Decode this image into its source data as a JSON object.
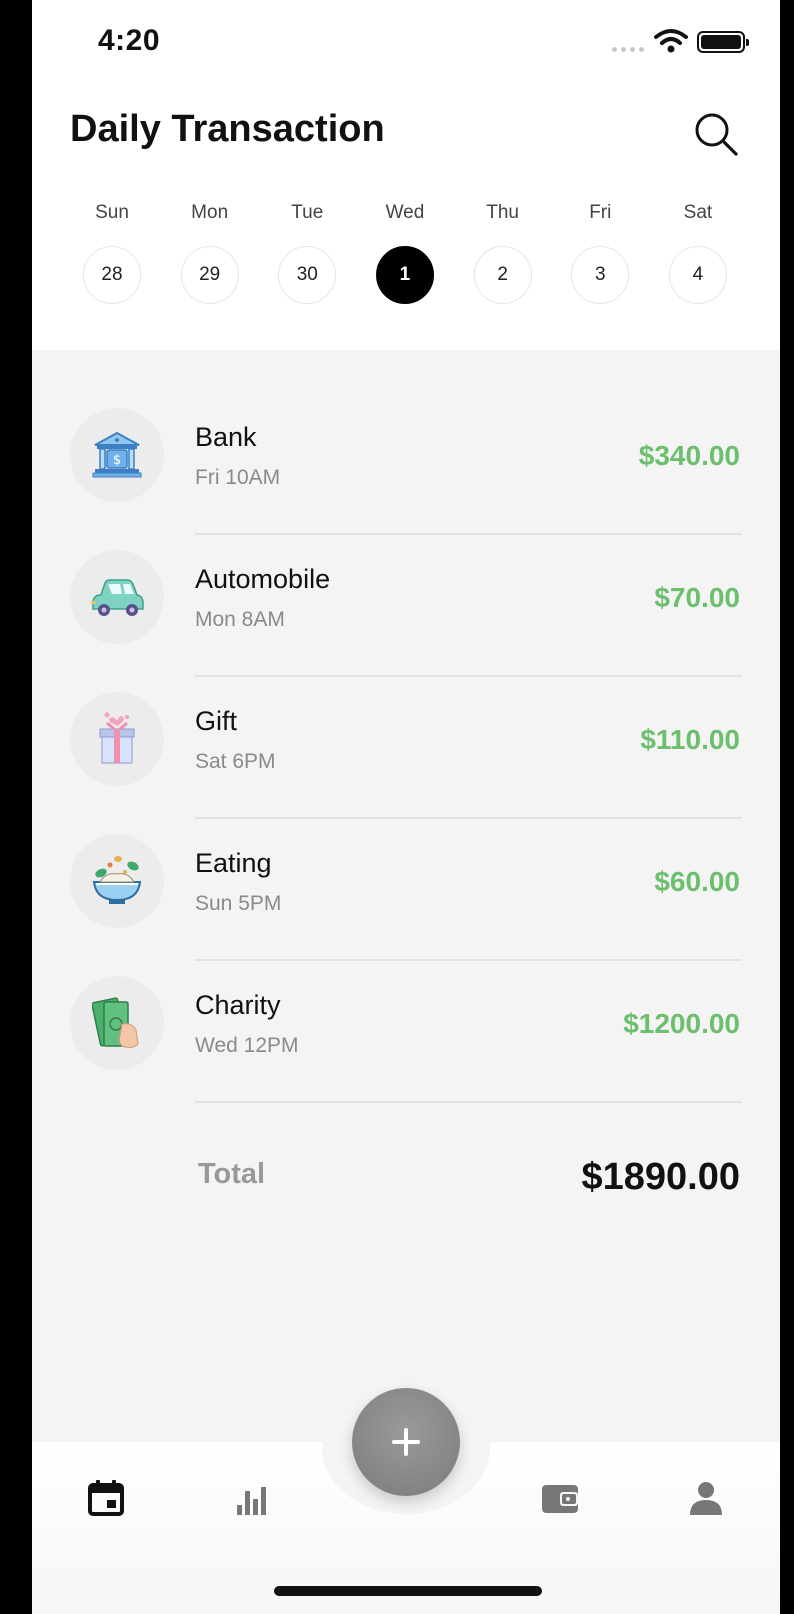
{
  "status_bar": {
    "time": "4:20"
  },
  "header": {
    "title": "Daily Transaction"
  },
  "week": [
    {
      "name": "Sun",
      "date": "28",
      "selected": false
    },
    {
      "name": "Mon",
      "date": "29",
      "selected": false
    },
    {
      "name": "Tue",
      "date": "30",
      "selected": false
    },
    {
      "name": "Wed",
      "date": "1",
      "selected": true
    },
    {
      "name": "Thu",
      "date": "2",
      "selected": false
    },
    {
      "name": "Fri",
      "date": "3",
      "selected": false
    },
    {
      "name": "Sat",
      "date": "4",
      "selected": false
    }
  ],
  "transactions": [
    {
      "icon": "bank-icon",
      "name": "Bank",
      "time": "Fri 10AM",
      "amount": "$340.00"
    },
    {
      "icon": "car-icon",
      "name": "Automobile",
      "time": "Mon 8AM",
      "amount": "$70.00"
    },
    {
      "icon": "gift-icon",
      "name": "Gift",
      "time": "Sat 6PM",
      "amount": "$110.00"
    },
    {
      "icon": "food-bowl-icon",
      "name": "Eating",
      "time": "Sun 5PM",
      "amount": "$60.00"
    },
    {
      "icon": "money-icon",
      "name": "Charity",
      "time": "Wed 12PM",
      "amount": "$1200.00"
    }
  ],
  "total": {
    "label": "Total",
    "value": "$1890.00"
  },
  "colors": {
    "accent_green": "#6cbf6d",
    "selected_day": "#000000",
    "fab": "#888888"
  },
  "bottom_nav": {
    "items": [
      {
        "icon": "calendar-icon",
        "active": true
      },
      {
        "icon": "bar-chart-icon",
        "active": false
      },
      {
        "icon": "plus-icon",
        "active": false
      },
      {
        "icon": "wallet-icon",
        "active": false
      },
      {
        "icon": "user-icon",
        "active": false
      }
    ]
  }
}
